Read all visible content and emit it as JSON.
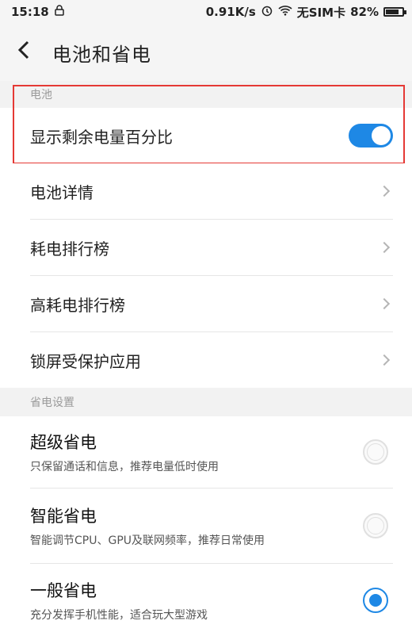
{
  "status_bar": {
    "time": "15:18",
    "network_speed": "0.91K/s",
    "sim_status": "无SIM卡",
    "battery_percent": "82%",
    "battery_level": 0.82
  },
  "header": {
    "title": "电池和省电",
    "back_icon": "chevron-left-icon"
  },
  "battery_section": {
    "header": "电池",
    "items": [
      {
        "label": "显示剩余电量百分比",
        "control": "toggle",
        "on": true
      },
      {
        "label": "电池详情",
        "control": "chevron"
      },
      {
        "label": "耗电排行榜",
        "control": "chevron"
      },
      {
        "label": "高耗电排行榜",
        "control": "chevron"
      },
      {
        "label": "锁屏受保护应用",
        "control": "chevron"
      }
    ]
  },
  "power_section": {
    "header": "省电设置",
    "modes": [
      {
        "title": "超级省电",
        "subtitle": "只保留通话和信息，推荐电量低时使用",
        "selected": false
      },
      {
        "title": "智能省电",
        "subtitle": "智能调节CPU、GPU及联网频率，推荐日常使用",
        "selected": false
      },
      {
        "title": "一般省电",
        "subtitle": "充分发挥手机性能，适合玩大型游戏",
        "selected": true
      }
    ]
  },
  "colors": {
    "accent": "#1e88e5",
    "highlight": "#e53935"
  }
}
